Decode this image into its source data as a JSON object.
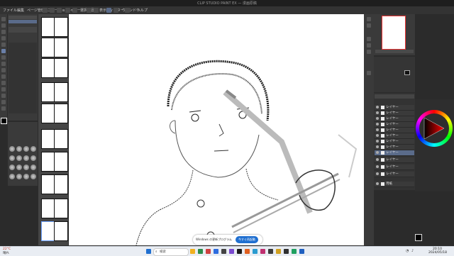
{
  "title_bar": {
    "text": "CLIP STUDIO PAINT EX — 漫画原稿"
  },
  "menu": {
    "items": [
      "ファイル",
      "編集",
      "ページ管理",
      "アニメーション",
      "レイヤー",
      "選択範囲",
      "表示",
      "フィルター",
      "ウィンドウ",
      "ヘルプ"
    ]
  },
  "layers": {
    "items": [
      "レイヤー",
      "レイヤー",
      "レイヤー",
      "レイヤー",
      "レイヤー",
      "レイヤー",
      "レイヤー",
      "レイヤー",
      "レイヤー",
      "レイヤー",
      "レイヤー",
      "レイヤー",
      "用紙"
    ]
  },
  "notification": {
    "text": "Windows の更新プログラム",
    "button": "今すぐ再起動"
  },
  "taskbar": {
    "weather_temp": "22°C",
    "weather_desc": "晴れ",
    "search_placeholder": "検索",
    "time": "20:10",
    "date": "2024/05/18"
  },
  "colors": {
    "accent": "#1f6fd0",
    "panel": "#3a3a3a",
    "canvas": "#ffffff"
  },
  "icons": [
    "menu-icon",
    "pen-icon",
    "eraser-icon",
    "brush-icon",
    "layer-eye-icon",
    "windows-start-icon",
    "search-icon",
    "wifi-icon",
    "volume-icon"
  ]
}
